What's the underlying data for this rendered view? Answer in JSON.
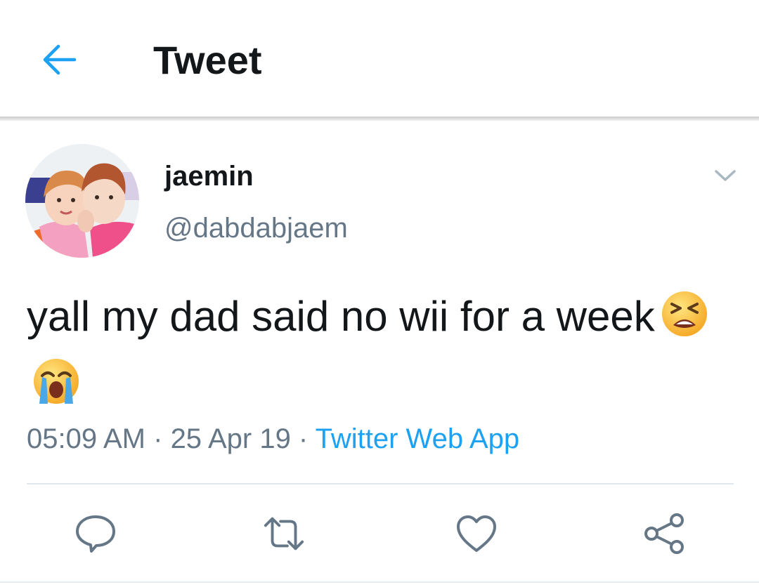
{
  "header": {
    "title": "Tweet",
    "back_icon": "arrow-left-icon",
    "accent": "#1da1f2"
  },
  "tweet": {
    "display_name": "jaemin",
    "handle": "@dabdabjaem",
    "text": "yall my dad said no wii for a week",
    "emojis": [
      "tired-face-emoji",
      "loudly-crying-face-emoji"
    ],
    "time": "05:09 AM",
    "date": "25 Apr 19",
    "source": "Twitter Web App"
  },
  "actions": [
    {
      "name": "reply",
      "icon": "speech-bubble-icon"
    },
    {
      "name": "retweet",
      "icon": "retweet-icon"
    },
    {
      "name": "like",
      "icon": "heart-icon"
    },
    {
      "name": "share",
      "icon": "share-icon"
    }
  ],
  "colors": {
    "text_primary": "#14171a",
    "text_secondary": "#657786",
    "link": "#1da1f2",
    "icon": "#657786"
  }
}
